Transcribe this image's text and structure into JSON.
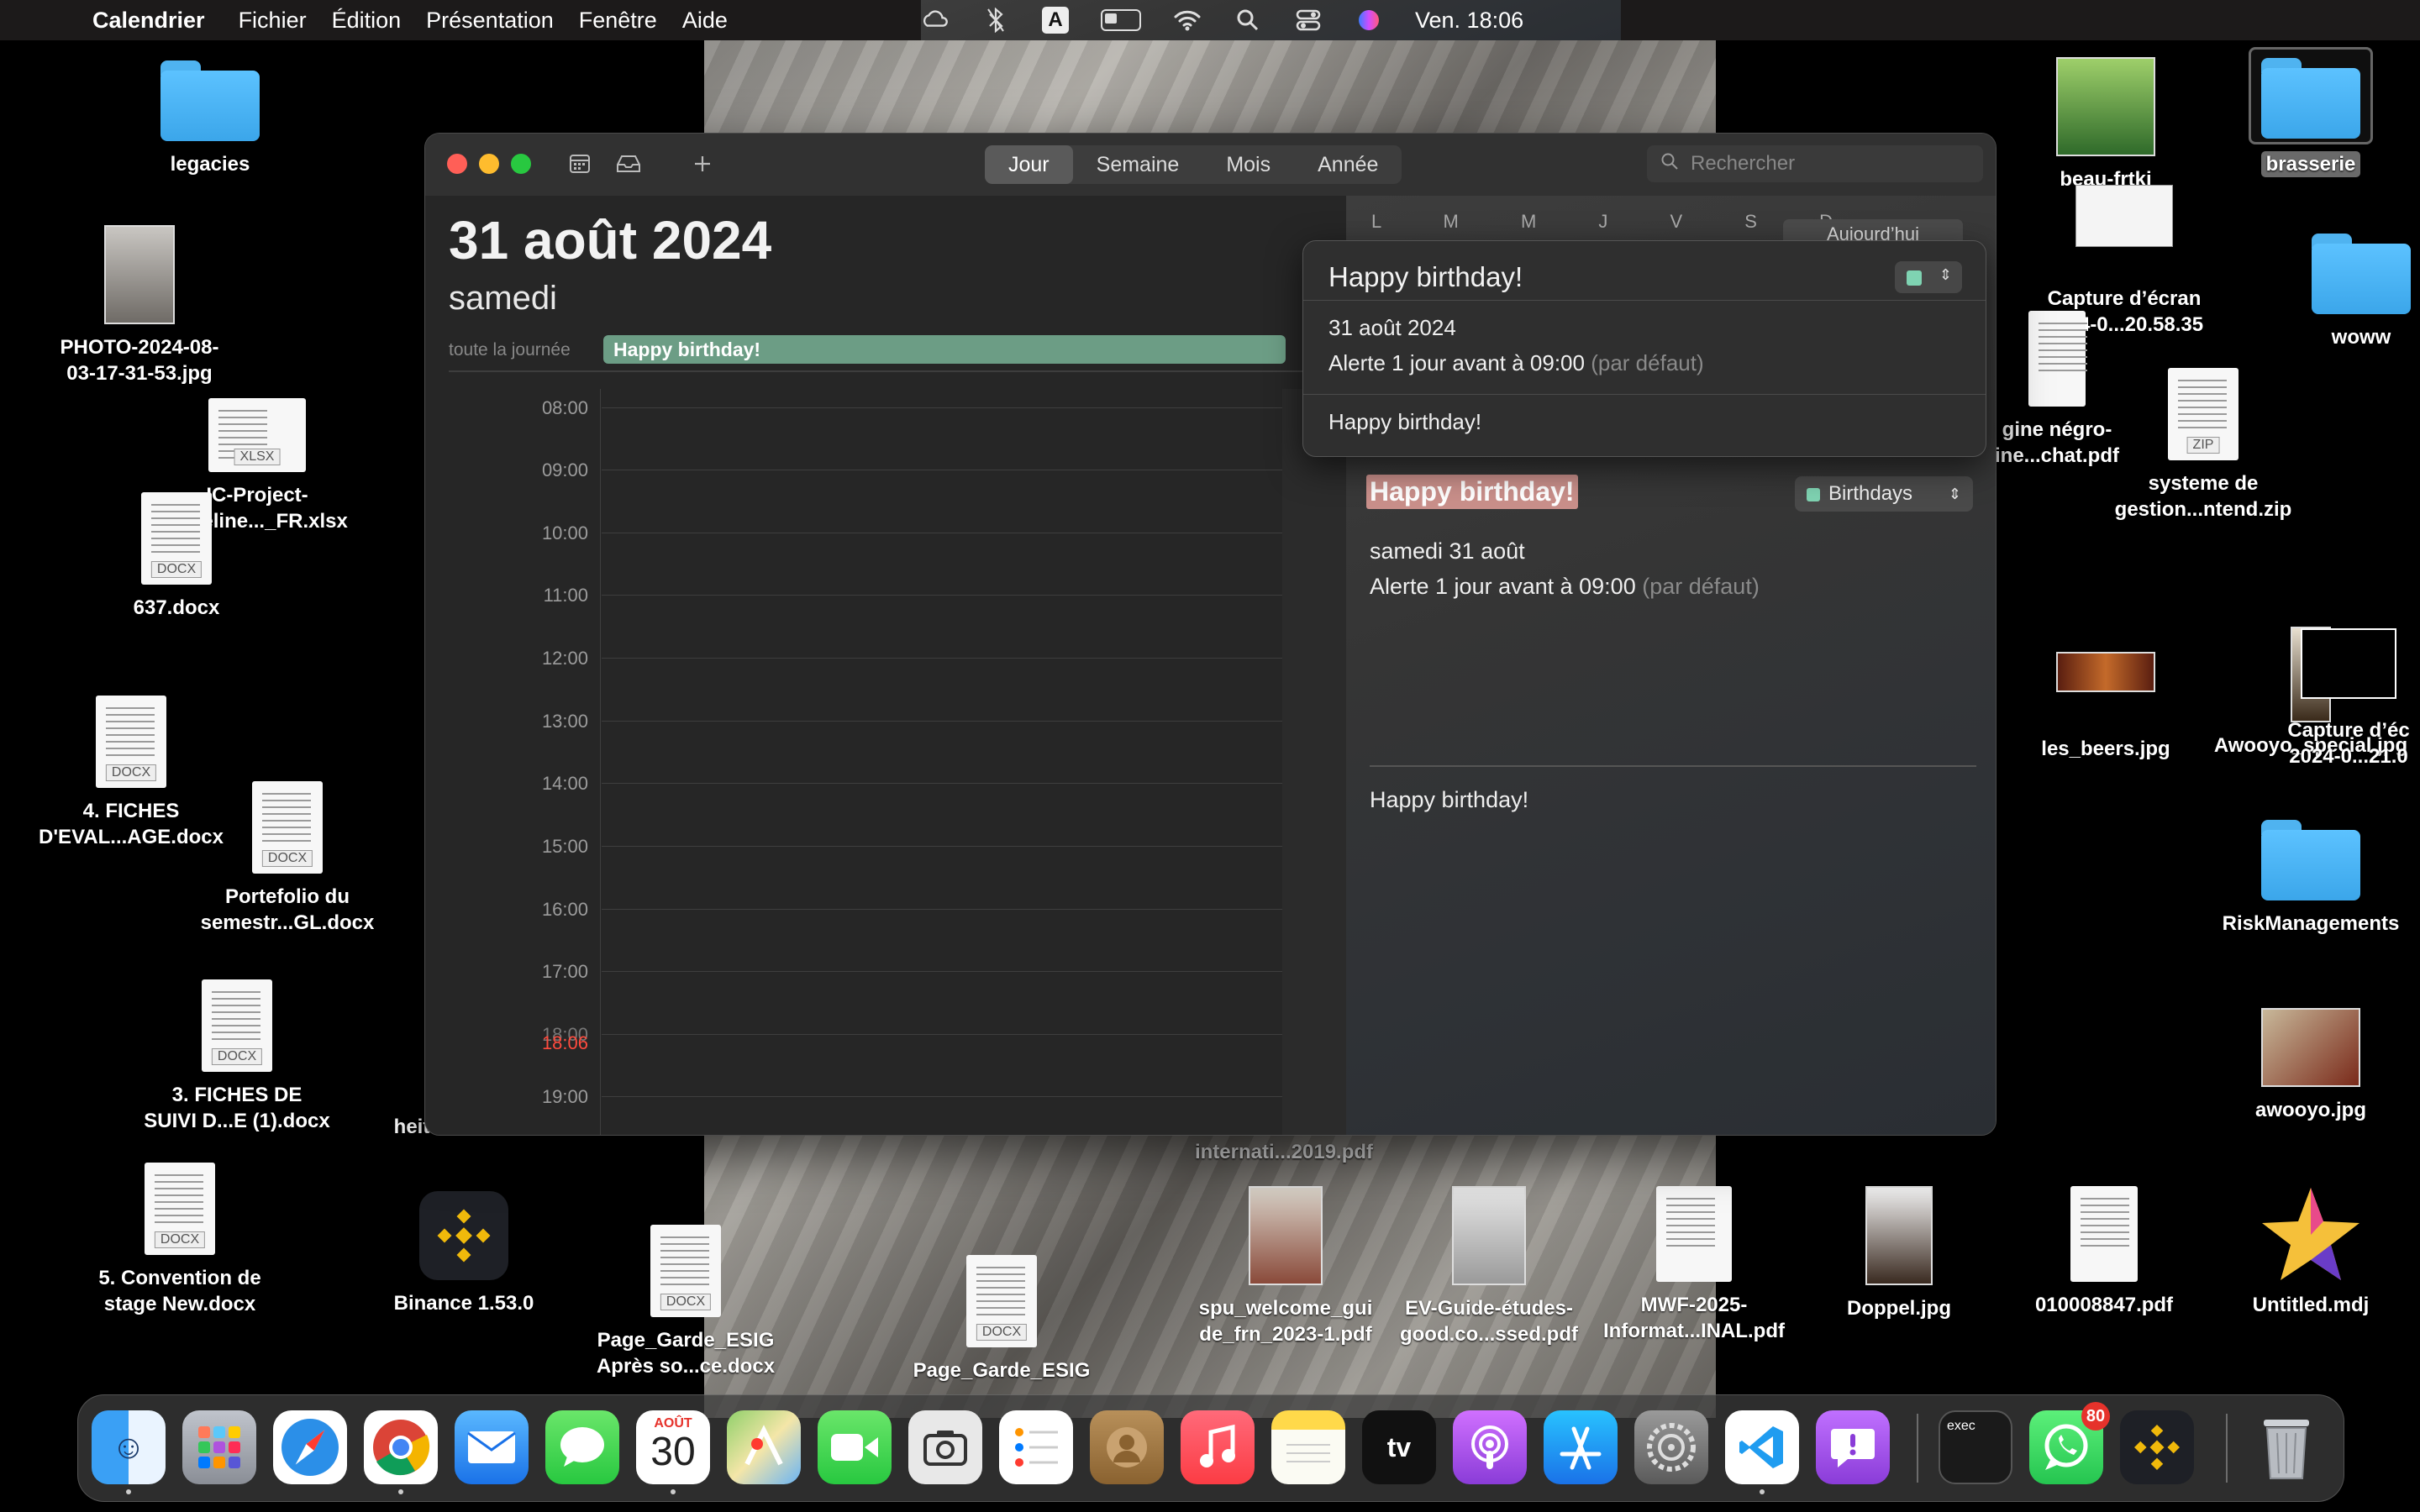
{
  "menubar": {
    "app_name": "Calendrier",
    "menus": [
      "Fichier",
      "Édition",
      "Présentation",
      "Fenêtre",
      "Aide"
    ],
    "input_letter": "A",
    "clock": "Ven. 18:06"
  },
  "desktop": {
    "icons": {
      "legacies": "legacies",
      "photo": "PHOTO-2024-08-\n03-17-31-53.jpg",
      "xlsx": "IC-Project-\nTimeline..._FR.xlsx",
      "docx637": "637.docx",
      "fiches_eval": "4. FICHES\nD'EVAL...AGE.docx",
      "portefolio": "Portefolio du\nsemestr...GL.docx",
      "fiches_suivi": "3. FICHES DE\nSUIVI D...E (1).docx",
      "convention": "5. Convention de\nstage New.docx",
      "binance": "Binance 1.53.0",
      "page_garde1": "Page_Garde_ESIG\nAprès so...ce.docx",
      "page_garde2": "Page_Garde_ESIG",
      "internati": "internati...2019.pdf",
      "spu": "spu_welcome_gui\nde_frn_2023-1.pdf",
      "ev_guide": "EV-Guide-études-\ngood.co...ssed.pdf",
      "mwf": "MWF-2025-\nInformat...INAL.pdf",
      "doppel": "Doppel.jpg",
      "pdf0100": "010008847.pdf",
      "untitled": "Untitled.mdj",
      "brasserie": "brasserie",
      "capture1": "Capture d’écran\n2024-0...20.58.35",
      "woww": "woww",
      "origine": "gine négro-\nine...chat.pdf",
      "systeme": "systeme de\ngestion...ntend.zip",
      "les_beers": "les_beers.jpg",
      "awooyo_special": "Awooyo_special.jpg",
      "capture2": "Capture d’éc\n2024-0...21.0",
      "risk": "RiskManagements",
      "awooyo": "awooyo.jpg",
      "beau": "beau-frtkj",
      "heit": "heit"
    },
    "file_tags": {
      "docx": "DOCX",
      "xlsx": "XLSX",
      "zip": "ZIP"
    }
  },
  "window": {
    "view_tabs": [
      "Jour",
      "Semaine",
      "Mois",
      "Année"
    ],
    "active_tab": "Jour",
    "search_placeholder": "Rechercher",
    "day_view": {
      "date_title": "31 août 2024",
      "weekday": "samedi",
      "allday_label": "toute la journée",
      "allday_event": "Happy birthday!",
      "hours": [
        "08:00",
        "09:00",
        "10:00",
        "11:00",
        "12:00",
        "13:00",
        "14:00",
        "15:00",
        "16:00",
        "17:00",
        "18:00",
        "19:00"
      ],
      "now_time": "18:06"
    },
    "mini_calendar": {
      "weekday_letters": "L M M J V S D",
      "today_button": "Aujourd’hui"
    },
    "event_detail": {
      "title": "Happy birthday!",
      "calendar": "Birthdays",
      "calendar_color": "#7fd3b2",
      "date_line": "samedi 31 août",
      "alert_text": "Alerte 1 jour avant à 09:00",
      "alert_default": "(par défaut)",
      "notes": "Happy birthday!"
    },
    "popover": {
      "title": "Happy birthday!",
      "date": "31 août 2024",
      "alert_text": "Alerte 1 jour avant à 09:00",
      "alert_default": "(par défaut)",
      "notes": "Happy birthday!"
    }
  },
  "dock": {
    "calendar_month": "AOÛT",
    "calendar_day": "30",
    "whatsapp_badge": "80",
    "terminal_label": "exec",
    "appletv_label": "tv"
  },
  "colors": {
    "event_green": "#6c9d85",
    "now_red": "#ff4b3e",
    "close": "#ff5f57",
    "minimize": "#febc2e",
    "zoom": "#28c840"
  }
}
